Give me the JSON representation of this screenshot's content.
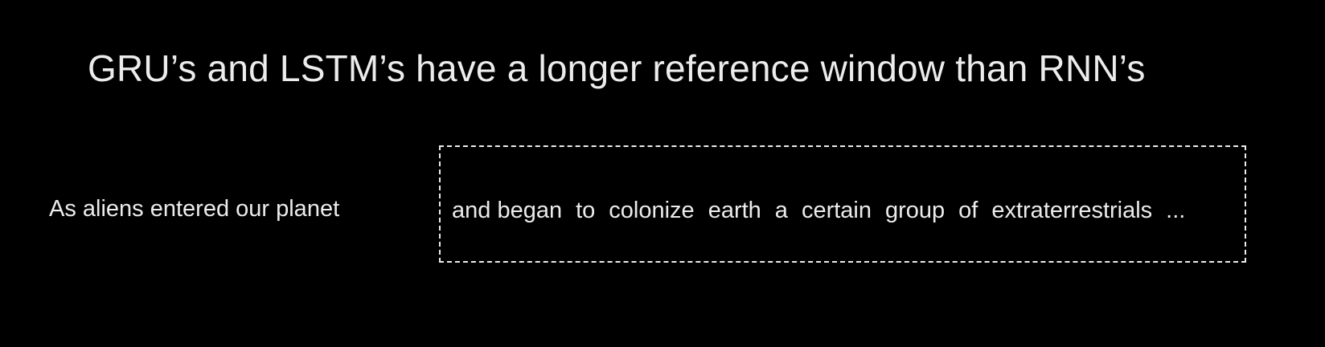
{
  "title": "GRU’s and LSTM’s have a longer reference window than RNN’s",
  "sentence": {
    "prefix": "As aliens entered our planet",
    "window_words": [
      "and began",
      "to",
      "colonize",
      "earth",
      "a",
      "certain",
      "group",
      "of",
      "extraterrestrials",
      "..."
    ]
  },
  "colors": {
    "background": "#000000",
    "text": "#ececec",
    "box_border": "#ececec"
  }
}
